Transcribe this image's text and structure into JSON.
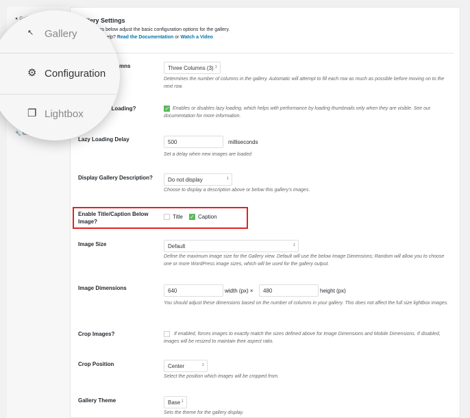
{
  "sidebar": {
    "items": [
      {
        "label": "Gallery",
        "icon": "leaf-icon"
      },
      {
        "label": "Misc",
        "icon": "wrench-icon"
      }
    ]
  },
  "magnifier": {
    "items": [
      {
        "label": "Gallery",
        "icon": "images-icon"
      },
      {
        "label": "Configuration",
        "icon": "gear-icon"
      },
      {
        "label": "Lightbox",
        "icon": "lightbox-icon"
      }
    ]
  },
  "header": {
    "title": "Gallery Settings",
    "intro": "The settings below adjust the basic configuration options for the gallery.",
    "help_prefix": "Need some help?",
    "doc_link": "Read the Documentation",
    "or": "or",
    "video_link": "Watch a Video"
  },
  "fields": {
    "columns": {
      "label": "Number of Columns",
      "value": "Three Columns (3)",
      "desc": "Determines the number of columns in the gallery. Automatic will attempt to fill each row as much as possible before moving on to the next row."
    },
    "lazy": {
      "label": "Enable Lazy Loading?",
      "checked": true,
      "desc": "Enables or disables lazy loading, which helps with performance by loading thumbnails only when they are visible. See our documentation for more information."
    },
    "lazy_delay": {
      "label": "Lazy Loading Delay",
      "value": "500",
      "unit": "milliseconds",
      "desc": "Set a delay when new images are loaded"
    },
    "description": {
      "label": "Display Gallery Description?",
      "value": "Do not display",
      "desc": "Choose to display a description above or below this gallery's images."
    },
    "title_caption": {
      "label": "Enable Title/Caption Below Image?",
      "title": "Title",
      "title_checked": false,
      "caption": "Caption",
      "caption_checked": true
    },
    "image_size": {
      "label": "Image Size",
      "value": "Default",
      "desc": "Define the maximum image size for the Gallery view. Default will use the below Image Dimensions; Random will allow you to choose one or more WordPress image sizes, which will be used for the gallery output."
    },
    "dimensions": {
      "label": "Image Dimensions",
      "width": "640",
      "width_unit": "width (px) ×",
      "height": "480",
      "height_unit": "height (px)",
      "desc": "You should adjust these dimensions based on the number of columns in your gallery. This does not affect the full size lightbox images."
    },
    "crop": {
      "label": "Crop Images?",
      "checked": false,
      "desc": "If enabled, forces images to exactly match the sizes defined above for Image Dimensions and Mobile Dimensions. If disabled, images will be resized to maintain their aspect ratio."
    },
    "crop_position": {
      "label": "Crop Position",
      "value": "Center",
      "desc": "Select the position which images will be cropped from."
    },
    "theme": {
      "label": "Gallery Theme",
      "value": "Base",
      "desc": "Sets the theme for the gallery display."
    }
  },
  "colors": {
    "highlight": "#e02020",
    "check": "#5cb85c",
    "link": "#0073aa"
  }
}
